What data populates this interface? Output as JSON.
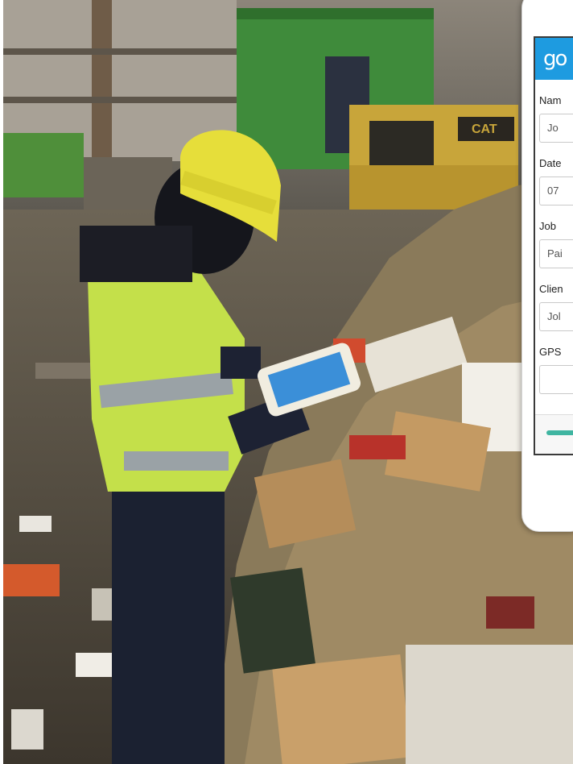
{
  "app": {
    "logo_text": "go",
    "brand_color": "#1e9be0",
    "accent_color": "#3fb5a1"
  },
  "form": {
    "fields": [
      {
        "label": "Nam",
        "value": "Jo"
      },
      {
        "label": "Date",
        "value": "07"
      },
      {
        "label": "Job",
        "value": "Pai"
      },
      {
        "label": "Clien",
        "value": "Jol"
      },
      {
        "label": "GPS",
        "value": ""
      }
    ]
  }
}
